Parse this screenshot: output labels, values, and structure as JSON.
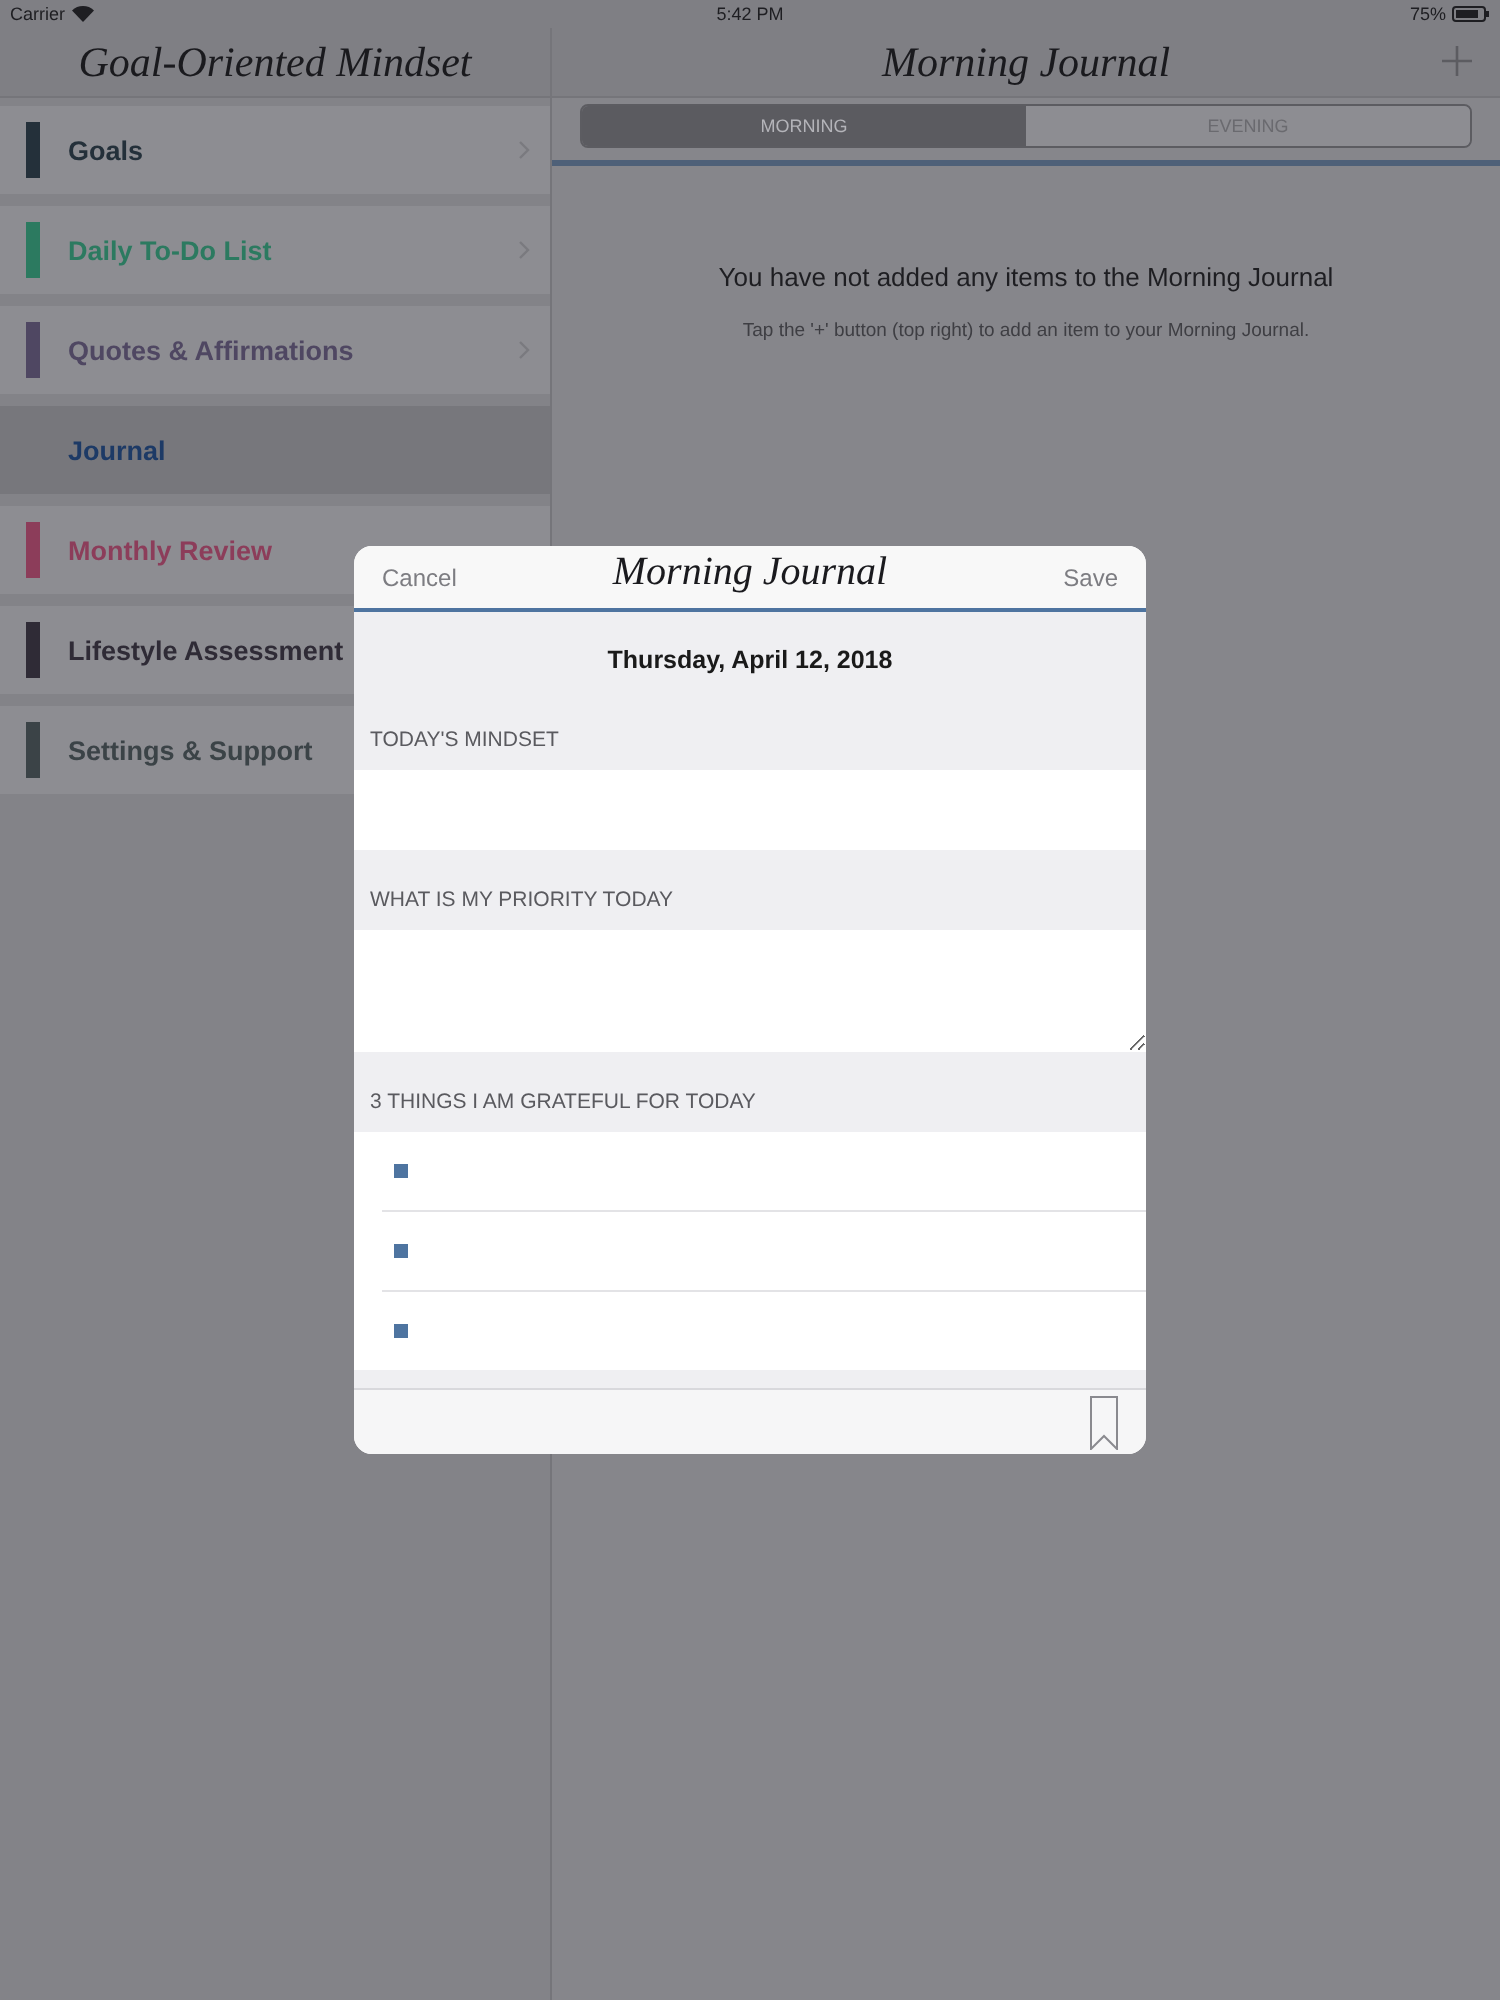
{
  "status_bar": {
    "carrier": "Carrier",
    "time": "5:42 PM",
    "battery": "75%"
  },
  "sidebar": {
    "title": "Goal-Oriented Mindset",
    "items": [
      {
        "label": "Goals",
        "color": "#24303a",
        "selected": false,
        "chevron": true
      },
      {
        "label": "Daily To-Do List",
        "color": "#2c7a60",
        "selected": false,
        "chevron": true
      },
      {
        "label": "Quotes & Affirmations",
        "color": "#4f4762",
        "selected": false,
        "chevron": true
      },
      {
        "label": "Journal",
        "selected": true,
        "chevron": false
      },
      {
        "label": "Monthly Review",
        "color": "#8c3d5a",
        "selected": false,
        "chevron": false
      },
      {
        "label": "Lifestyle Assessment",
        "color": "#2f2b36",
        "selected": false,
        "chevron": false
      },
      {
        "label": "Settings & Support",
        "color": "#3b4347",
        "selected": false,
        "chevron": false
      }
    ]
  },
  "main": {
    "title": "Morning Journal",
    "segments": [
      {
        "label": "MORNING",
        "selected": true
      },
      {
        "label": "EVENING",
        "selected": false
      }
    ],
    "empty_state": {
      "message": "You have not added any items to the Morning Journal",
      "hint": "Tap the '+' button (top right) to add an item to your Morning Journal."
    }
  },
  "modal": {
    "cancel": "Cancel",
    "title": "Morning Journal",
    "save": "Save",
    "date": "Thursday, April 12, 2018",
    "sections": [
      {
        "heading": "TODAY'S MINDSET",
        "kind": "single_line"
      },
      {
        "heading": "WHAT IS MY PRIORITY TODAY",
        "kind": "multi_line"
      },
      {
        "heading": "3 THINGS I AM GRATEFUL FOR TODAY",
        "kind": "bullets",
        "items": [
          {
            "kind": "bullet"
          },
          {
            "kind": "bullet"
          },
          {
            "kind": "bullet"
          }
        ]
      }
    ]
  }
}
